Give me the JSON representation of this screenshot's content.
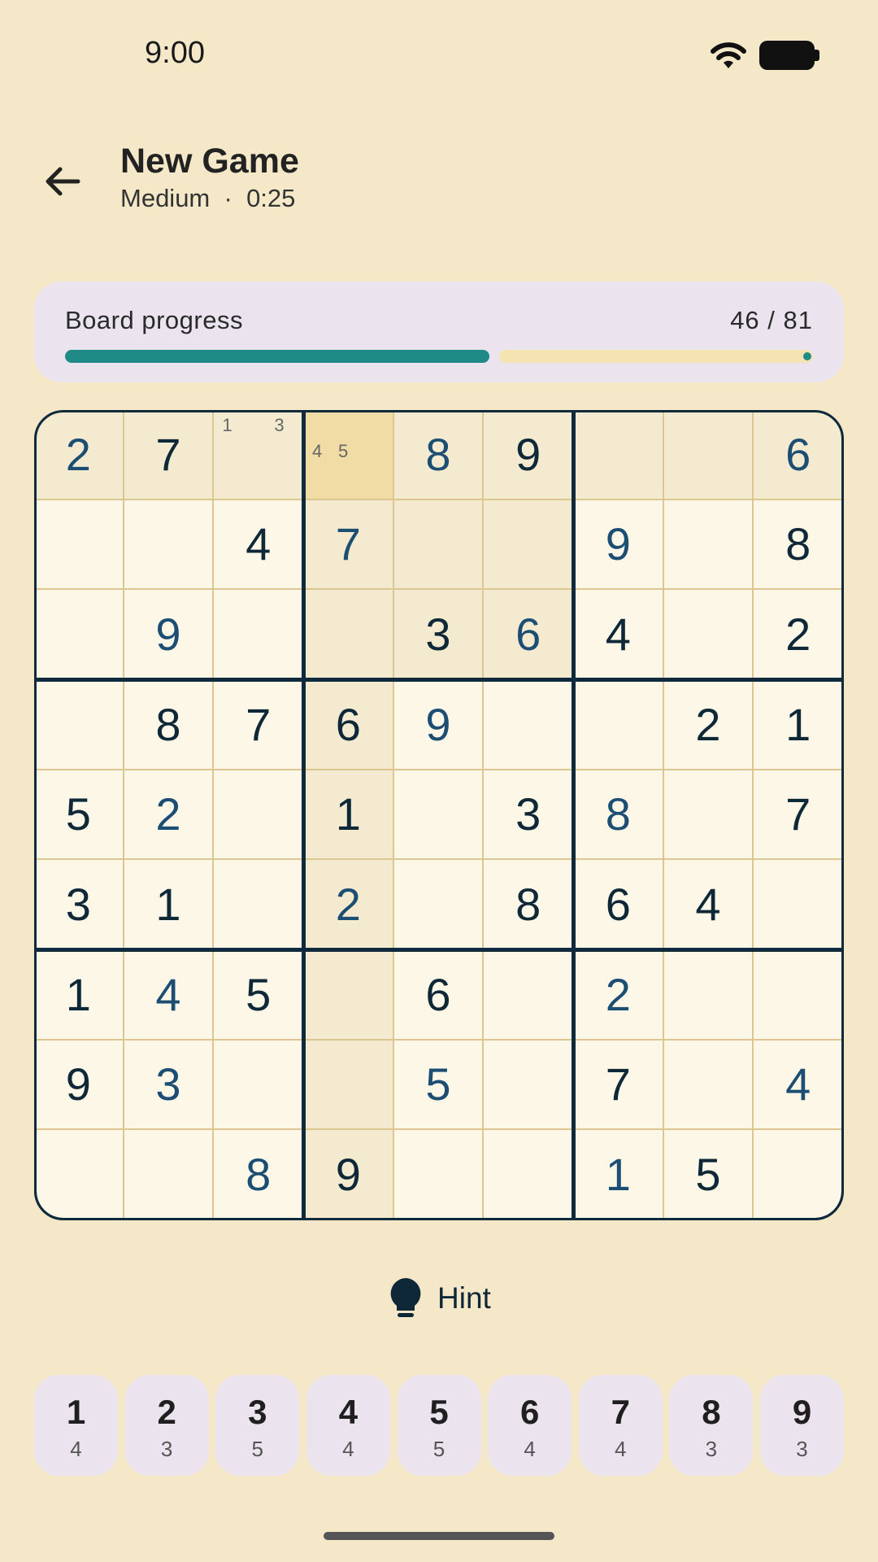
{
  "status": {
    "time": "9:00"
  },
  "header": {
    "title": "New Game",
    "difficulty": "Medium",
    "separator": "·",
    "timer": "0:25"
  },
  "progress": {
    "label": "Board progress",
    "filled": 46,
    "total": 81,
    "count_text": "46 / 81"
  },
  "board": {
    "selected": [
      0,
      3
    ],
    "notes": {
      "0,2": [
        "1",
        "3"
      ],
      "0,3": [
        "4",
        "5"
      ]
    },
    "rows": [
      [
        {
          "v": "2",
          "k": "user"
        },
        {
          "v": "7",
          "k": "given"
        },
        {
          "v": "",
          "k": ""
        },
        {
          "v": "",
          "k": ""
        },
        {
          "v": "8",
          "k": "user"
        },
        {
          "v": "9",
          "k": "given"
        },
        {
          "v": "",
          "k": ""
        },
        {
          "v": "",
          "k": ""
        },
        {
          "v": "6",
          "k": "user"
        }
      ],
      [
        {
          "v": "",
          "k": ""
        },
        {
          "v": "",
          "k": ""
        },
        {
          "v": "4",
          "k": "given"
        },
        {
          "v": "7",
          "k": "user"
        },
        {
          "v": "",
          "k": ""
        },
        {
          "v": "",
          "k": ""
        },
        {
          "v": "9",
          "k": "user"
        },
        {
          "v": "",
          "k": ""
        },
        {
          "v": "8",
          "k": "given"
        }
      ],
      [
        {
          "v": "",
          "k": ""
        },
        {
          "v": "9",
          "k": "user"
        },
        {
          "v": "",
          "k": ""
        },
        {
          "v": "",
          "k": ""
        },
        {
          "v": "3",
          "k": "given"
        },
        {
          "v": "6",
          "k": "user"
        },
        {
          "v": "4",
          "k": "given"
        },
        {
          "v": "",
          "k": ""
        },
        {
          "v": "2",
          "k": "given"
        }
      ],
      [
        {
          "v": "",
          "k": ""
        },
        {
          "v": "8",
          "k": "given"
        },
        {
          "v": "7",
          "k": "given"
        },
        {
          "v": "6",
          "k": "given"
        },
        {
          "v": "9",
          "k": "user"
        },
        {
          "v": "",
          "k": ""
        },
        {
          "v": "",
          "k": ""
        },
        {
          "v": "2",
          "k": "given"
        },
        {
          "v": "1",
          "k": "given"
        }
      ],
      [
        {
          "v": "5",
          "k": "given"
        },
        {
          "v": "2",
          "k": "user"
        },
        {
          "v": "",
          "k": ""
        },
        {
          "v": "1",
          "k": "given"
        },
        {
          "v": "",
          "k": ""
        },
        {
          "v": "3",
          "k": "given"
        },
        {
          "v": "8",
          "k": "user"
        },
        {
          "v": "",
          "k": ""
        },
        {
          "v": "7",
          "k": "given"
        }
      ],
      [
        {
          "v": "3",
          "k": "given"
        },
        {
          "v": "1",
          "k": "given"
        },
        {
          "v": "",
          "k": ""
        },
        {
          "v": "2",
          "k": "user"
        },
        {
          "v": "",
          "k": ""
        },
        {
          "v": "8",
          "k": "given"
        },
        {
          "v": "6",
          "k": "given"
        },
        {
          "v": "4",
          "k": "given"
        },
        {
          "v": "",
          "k": ""
        }
      ],
      [
        {
          "v": "1",
          "k": "given"
        },
        {
          "v": "4",
          "k": "user"
        },
        {
          "v": "5",
          "k": "given"
        },
        {
          "v": "",
          "k": ""
        },
        {
          "v": "6",
          "k": "given"
        },
        {
          "v": "",
          "k": ""
        },
        {
          "v": "2",
          "k": "user"
        },
        {
          "v": "",
          "k": ""
        },
        {
          "v": "",
          "k": ""
        }
      ],
      [
        {
          "v": "9",
          "k": "given"
        },
        {
          "v": "3",
          "k": "user"
        },
        {
          "v": "",
          "k": ""
        },
        {
          "v": "",
          "k": ""
        },
        {
          "v": "5",
          "k": "user"
        },
        {
          "v": "",
          "k": ""
        },
        {
          "v": "7",
          "k": "given"
        },
        {
          "v": "",
          "k": ""
        },
        {
          "v": "4",
          "k": "user"
        }
      ],
      [
        {
          "v": "",
          "k": ""
        },
        {
          "v": "",
          "k": ""
        },
        {
          "v": "8",
          "k": "user"
        },
        {
          "v": "9",
          "k": "given"
        },
        {
          "v": "",
          "k": ""
        },
        {
          "v": "",
          "k": ""
        },
        {
          "v": "1",
          "k": "user"
        },
        {
          "v": "5",
          "k": "given"
        },
        {
          "v": "",
          "k": ""
        }
      ]
    ]
  },
  "hint": {
    "label": "Hint",
    "icon": "lightbulb-icon"
  },
  "numpad": [
    {
      "digit": "1",
      "remaining": "4"
    },
    {
      "digit": "2",
      "remaining": "3"
    },
    {
      "digit": "3",
      "remaining": "5"
    },
    {
      "digit": "4",
      "remaining": "4"
    },
    {
      "digit": "5",
      "remaining": "5"
    },
    {
      "digit": "6",
      "remaining": "4"
    },
    {
      "digit": "7",
      "remaining": "4"
    },
    {
      "digit": "8",
      "remaining": "3"
    },
    {
      "digit": "9",
      "remaining": "3"
    }
  ],
  "colors": {
    "accent": "#1f8a86",
    "background": "#f4e8c8",
    "given_digit": "#0f2838",
    "user_digit": "#1c4e74",
    "selected_cell": "#f0dca4",
    "highlight": "#f3ead0"
  }
}
